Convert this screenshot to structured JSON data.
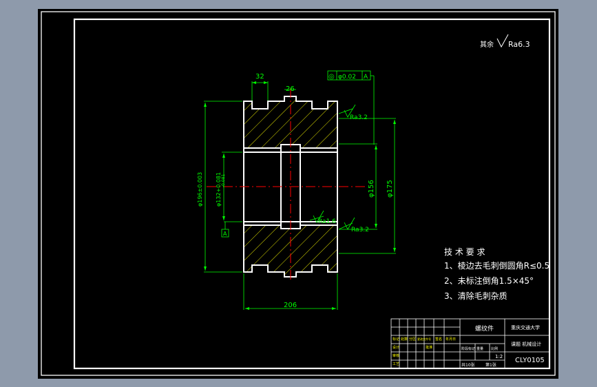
{
  "colors": {
    "frame_bg": "#8e9aab",
    "paper": "#000000",
    "line": "#ffffff",
    "dimension": "#00ff00",
    "center": "#ff0000",
    "hatch": "#ffff00"
  },
  "roughness_general": {
    "prefix": "其余",
    "value": "Ra6.3"
  },
  "dimensions": {
    "key_width_32": "32",
    "key_width_26": "26",
    "diam_outer": "φ196±0.003",
    "diam_bore": "φ132+0.081",
    "diam_bore_tol": "-0.081",
    "diam_156": "φ156",
    "diam_175": "φ175",
    "width_206": "206"
  },
  "tolerance_frame": {
    "symbol": "◎",
    "value": "φ0.02",
    "datum": "A"
  },
  "datum_label": "A",
  "roughness_marks": [
    {
      "value": "Ra3.2"
    },
    {
      "value": "Ra1.6"
    },
    {
      "value": "Ra3.2"
    }
  ],
  "tech_requirements": {
    "title": "技 术 要 求",
    "items": [
      "1、棱边去毛刺倒圆角R≤0.5",
      "2、未标注倒角1.5×45°",
      "3、清除毛刺杂质"
    ]
  },
  "title_block": {
    "part_name": "螺纹件",
    "school": "重庆交通大学",
    "course": "课题 机械设计",
    "drawing_no": "CLY0105",
    "scale": "1:2",
    "sheet": "共10张",
    "sheet_no": "第1张",
    "labels": [
      "标记",
      "处数",
      "分区",
      "更改文件号",
      "签名",
      "年月日",
      "设计",
      "审核",
      "工艺",
      "批准",
      "阶段标记",
      "重量",
      "比例"
    ]
  }
}
